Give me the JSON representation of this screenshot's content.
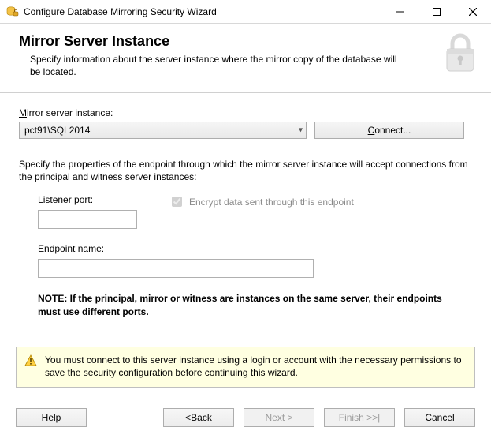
{
  "window": {
    "title": "Configure Database Mirroring Security Wizard"
  },
  "header": {
    "heading": "Mirror Server Instance",
    "subtitle": "Specify information about the server instance where the mirror copy of the database will be located."
  },
  "form": {
    "instance_label": "Mirror server instance:",
    "instance_value": "pct91\\SQL2014",
    "connect_button": "Connect...",
    "connect_button_hotkey": "C",
    "properties_instruction": "Specify the properties of the endpoint through which the mirror server instance will accept connections from the principal and witness server instances:",
    "listener_port_label": "Listener port:",
    "listener_port_value": "",
    "encrypt_label": "Encrypt data sent through this endpoint",
    "encrypt_checked": true,
    "endpoint_name_label": "Endpoint name:",
    "endpoint_name_value": "",
    "note": "NOTE: If the principal, mirror or witness are instances on the same server, their endpoints must use different ports."
  },
  "warning": {
    "text": "You must connect to this server instance using a login or account with the necessary permissions to save the security configuration before continuing this wizard."
  },
  "footer": {
    "help": "Help",
    "back": "< Back",
    "next": "Next >",
    "finish": "Finish >>|",
    "cancel": "Cancel"
  },
  "icons": {
    "app": "database-lock-icon",
    "lock": "padlock-icon",
    "warning": "warning-triangle-icon"
  }
}
